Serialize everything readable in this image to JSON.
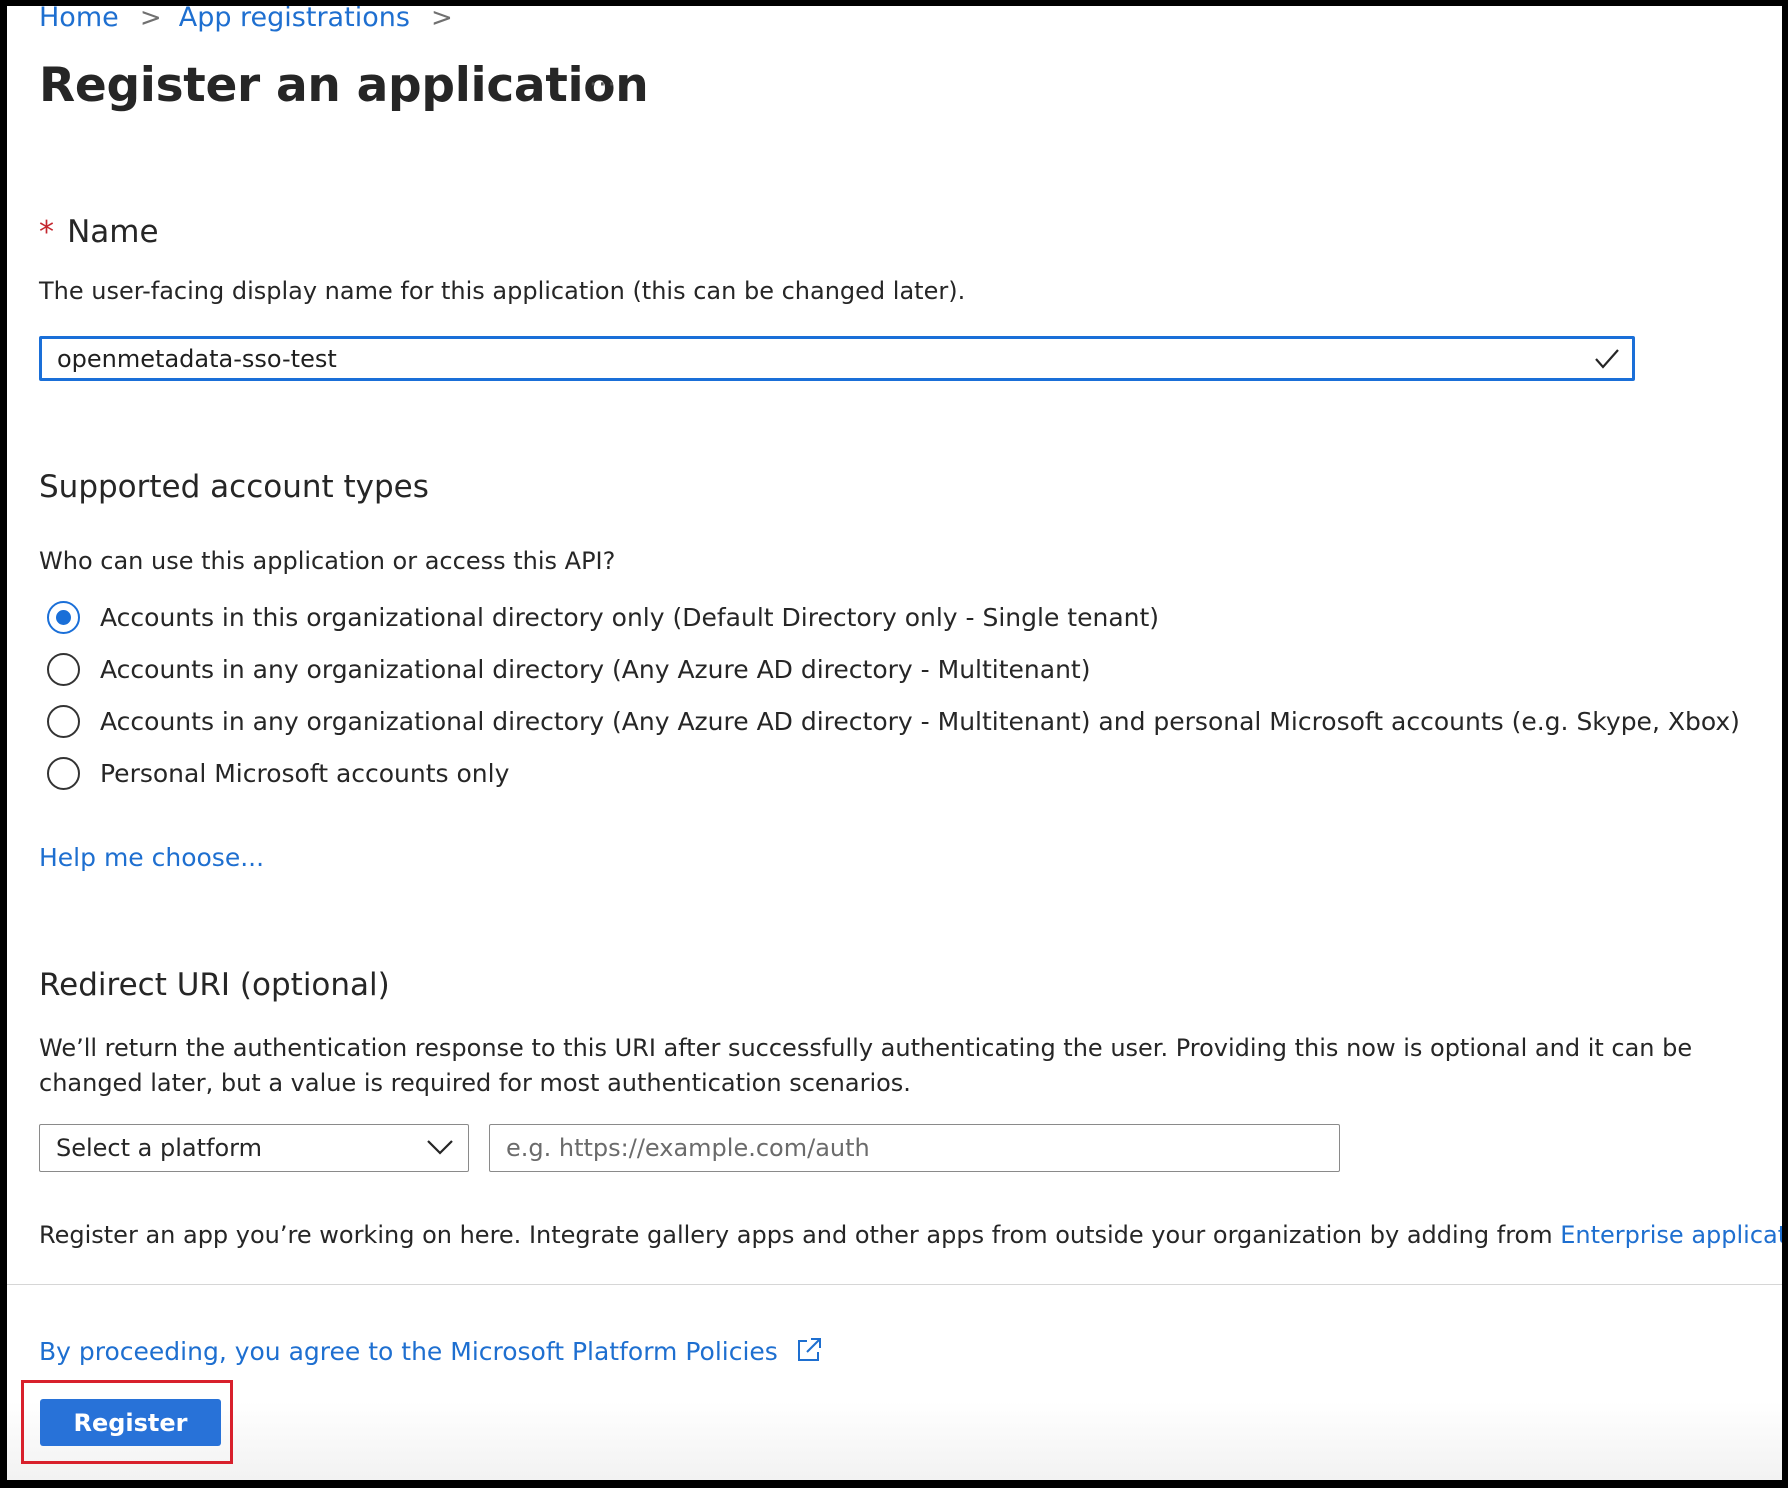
{
  "breadcrumb": {
    "items": [
      "Home",
      "App registrations"
    ],
    "separator": ">"
  },
  "header": {
    "title": "Register an application",
    "more_label": "···"
  },
  "name_section": {
    "required_marker": "*",
    "label": "Name",
    "description": "The user-facing display name for this application (this can be changed later).",
    "value": "openmetadata-sso-test",
    "valid_icon": "checkmark-icon"
  },
  "account_types": {
    "heading": "Supported account types",
    "question": "Who can use this application or access this API?",
    "options": [
      {
        "label": "Accounts in this organizational directory only (Default Directory only - Single tenant)",
        "selected": true
      },
      {
        "label": "Accounts in any organizational directory (Any Azure AD directory - Multitenant)",
        "selected": false
      },
      {
        "label": "Accounts in any organizational directory (Any Azure AD directory - Multitenant) and personal Microsoft accounts (e.g. Skype, Xbox)",
        "selected": false
      },
      {
        "label": "Personal Microsoft accounts only",
        "selected": false
      }
    ],
    "help_link": "Help me choose..."
  },
  "redirect_uri": {
    "heading": "Redirect URI (optional)",
    "description_line1": "We’ll return the authentication response to this URI after successfully authenticating the user. Providing this now is optional and it can be",
    "description_line2": "changed later, but a value is required for most authentication scenarios.",
    "platform_select": "Select a platform",
    "uri_placeholder": "e.g. https://example.com/auth",
    "uri_value": ""
  },
  "gallery_note": {
    "text": "Register an app you’re working on here. Integrate gallery apps and other apps from outside your organization by adding from ",
    "link": "Enterprise applications",
    "suffix": "."
  },
  "footer": {
    "policy_link": "By proceeding, you agree to the Microsoft Platform Policies",
    "register_label": "Register"
  },
  "colors": {
    "accent": "#1a6fd8",
    "link": "#1e6fd0",
    "required": "#c4262e",
    "highlight": "#d8202c",
    "button": "#2872d8"
  }
}
